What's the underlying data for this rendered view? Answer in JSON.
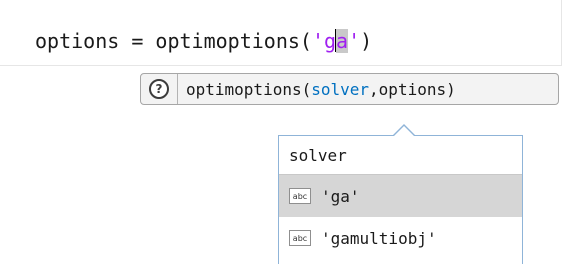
{
  "editor": {
    "code_prefix": "options = optimoptions(",
    "string_open": "'",
    "string_typed_before_caret": "g",
    "string_typed_after_caret": "a",
    "string_close": "'",
    "code_suffix": ")"
  },
  "hint": {
    "icon": "question-circle-icon",
    "function_name": "optimoptions(",
    "active_arg": "solver",
    "separator": ",",
    "other_arg": "options",
    "close_paren": ")"
  },
  "completion": {
    "header": "solver",
    "items": [
      {
        "icon": "abc-string-icon",
        "icon_text": "abc",
        "label": "'ga'",
        "selected": true
      },
      {
        "icon": "abc-string-icon",
        "icon_text": "abc",
        "label": "'gamultiobj'",
        "selected": false
      }
    ]
  },
  "colors": {
    "string": "#a020f0",
    "active_argument": "#0070c0",
    "popup_border": "#8fb4d8",
    "selected_item": "#d6d6d6"
  }
}
